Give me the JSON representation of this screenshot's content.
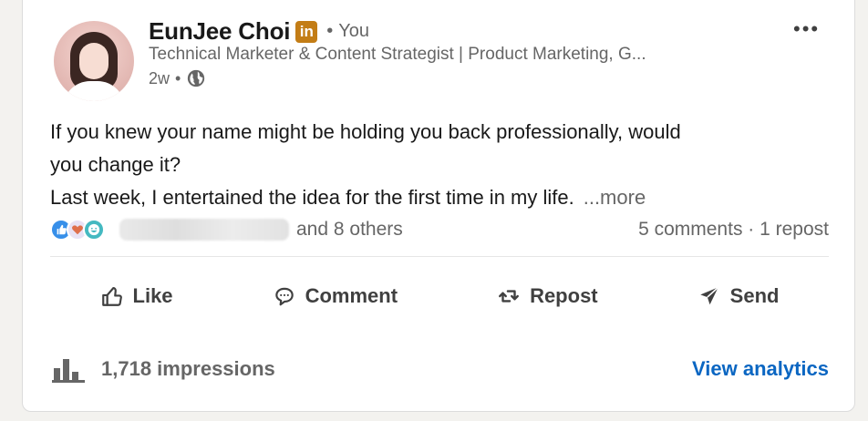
{
  "post": {
    "author": {
      "name": "EunJee Choi",
      "badge": "in",
      "relation_sep": "•",
      "relation": "You",
      "headline": "Technical Marketer & Content Strategist | Product Marketing, G...",
      "time": "2w",
      "time_sep": "•",
      "visibility_icon": "globe-icon"
    },
    "menu_icon": "•••",
    "text_line1": "If you knew your name might be holding you back professionally, would",
    "text_line2": "you change it?",
    "text_line3": "Last week, I entertained the idea for the first time in my life.",
    "more_label": "...more",
    "reactions": {
      "icons": [
        "like-reaction-icon",
        "love-reaction-icon",
        "funny-reaction-icon"
      ],
      "others_label": "and 8 others"
    },
    "counts": "5 comments · 1 repost"
  },
  "actions": {
    "like": "Like",
    "comment": "Comment",
    "repost": "Repost",
    "send": "Send"
  },
  "footer": {
    "impressions": "1,718 impressions",
    "view_analytics": "View analytics"
  },
  "colors": {
    "brand_blue": "#0a66c2",
    "premium_gold": "#c37d16",
    "text_primary": "#191919",
    "text_secondary": "#666666"
  }
}
